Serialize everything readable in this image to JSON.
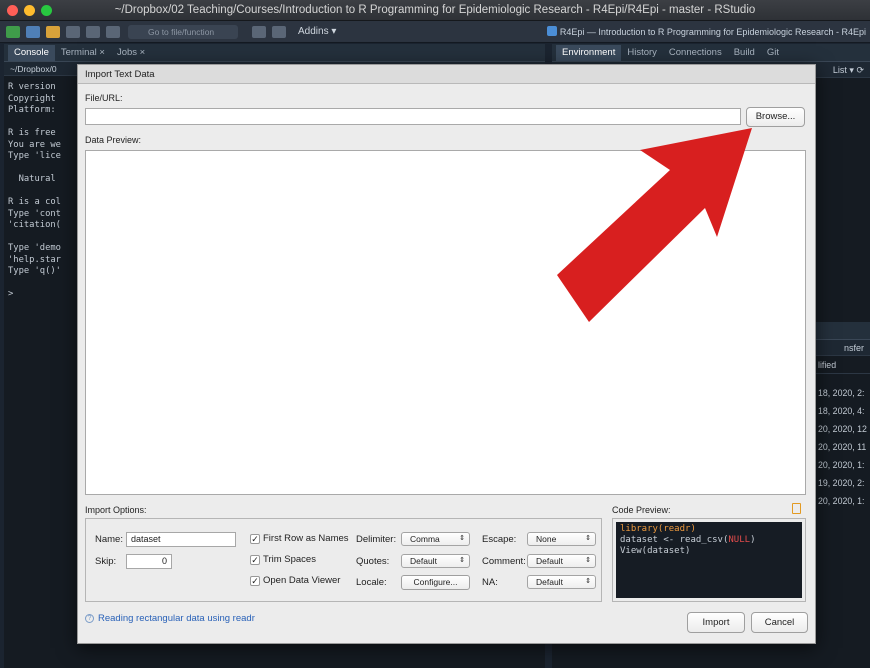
{
  "window": {
    "title": "~/Dropbox/02 Teaching/Courses/Introduction to R Programming for Epidemiologic Research - R4Epi/R4Epi - master - RStudio"
  },
  "toolbar": {
    "goto_placeholder": "Go to file/function",
    "addins_label": "Addins ▾",
    "project_label": "R4Epi — Introduction to R Programming for Epidemiologic Research - R4Epi"
  },
  "left_pane": {
    "tabs": [
      "Console",
      "Terminal ×",
      "Jobs ×"
    ],
    "path": "~/Dropbox/0",
    "console_lines": [
      "R version",
      "Copyright",
      "Platform: ",
      "",
      "R is free ",
      "You are we",
      "Type 'lice",
      "",
      "  Natural ",
      "",
      "R is a col",
      "Type 'cont",
      "'citation(",
      "",
      "Type 'demo",
      "'help.star",
      "Type 'q()'",
      "",
      ">"
    ]
  },
  "right_pane": {
    "tabs": [
      "Environment",
      "History",
      "Connections",
      "Build",
      "Git"
    ],
    "list_label": "List ▾",
    "lower_sub": "nsfer",
    "lower_header": "lified",
    "file_dates": [
      "18, 2020, 2:",
      "18, 2020, 4:",
      "20, 2020, 12",
      "20, 2020, 11",
      "20, 2020, 1:",
      "19, 2020, 2:",
      "20, 2020, 1:"
    ]
  },
  "dialog": {
    "title": "Import Text Data",
    "file_url_label": "File/URL:",
    "file_url_value": "",
    "browse_label": "Browse...",
    "data_preview_label": "Data Preview:",
    "import_options_label": "Import Options:",
    "name_label": "Name:",
    "name_value": "dataset",
    "skip_label": "Skip:",
    "skip_value": "0",
    "first_row_label": "First Row as Names",
    "first_row_checked": "✓",
    "trim_spaces_label": "Trim Spaces",
    "trim_spaces_checked": "✓",
    "open_viewer_label": "Open Data Viewer",
    "open_viewer_checked": "✓",
    "delimiter_label": "Delimiter:",
    "delimiter_value": "Comma",
    "quotes_label": "Quotes:",
    "quotes_value": "Default",
    "locale_label": "Locale:",
    "locale_button": "Configure...",
    "escape_label": "Escape:",
    "escape_value": "None",
    "comment_label": "Comment:",
    "comment_value": "Default",
    "na_label": "NA:",
    "na_value": "Default",
    "code_preview_label": "Code Preview:",
    "code_line1": "library(readr)",
    "code_line2_a": "dataset <- read_csv(",
    "code_line2_null": "NULL",
    "code_line2_b": ")",
    "code_line3": "View(dataset)",
    "help_link": "Reading rectangular data using readr",
    "import_button": "Import",
    "cancel_button": "Cancel"
  },
  "colors": {
    "arrow": "#d81f1f",
    "link": "#2a62b8"
  }
}
